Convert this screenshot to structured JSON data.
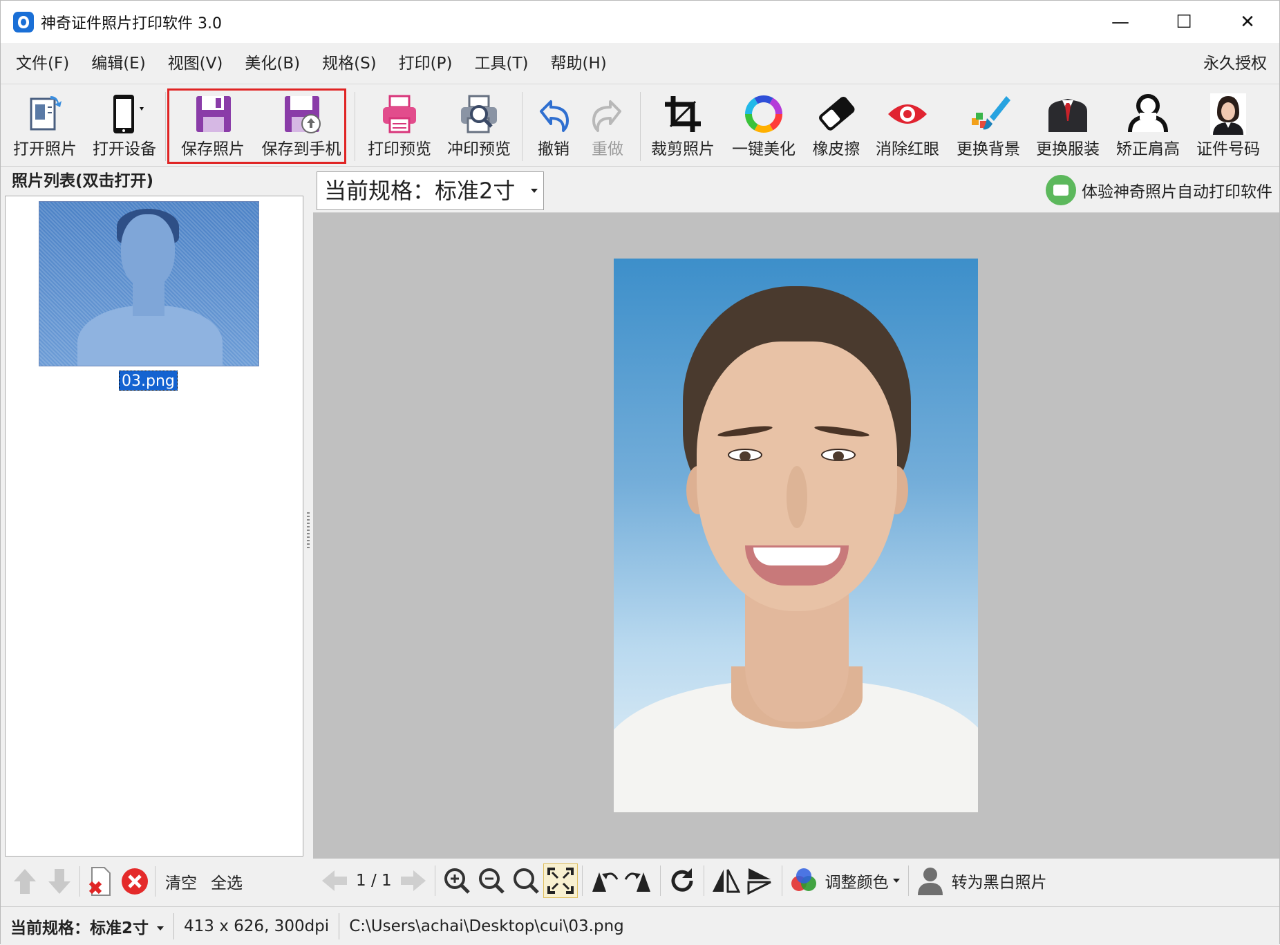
{
  "window": {
    "title": "神奇证件照片打印软件 3.0",
    "minimize": "—",
    "maximize": "☐",
    "close": "✕"
  },
  "menu": {
    "items": [
      "文件(F)",
      "编辑(E)",
      "视图(V)",
      "美化(B)",
      "规格(S)",
      "打印(P)",
      "工具(T)",
      "帮助(H)"
    ],
    "license": "永久授权"
  },
  "toolbar": {
    "open_photo": "打开照片",
    "open_device": "打开设备",
    "save_photo": "保存照片",
    "save_to_phone": "保存到手机",
    "print_preview": "打印预览",
    "develop_preview": "冲印预览",
    "undo": "撤销",
    "redo": "重做",
    "crop": "裁剪照片",
    "beautify": "一键美化",
    "eraser": "橡皮擦",
    "red_eye": "消除红眼",
    "change_bg": "更换背景",
    "change_clothes": "更换服装",
    "fix_shoulders": "矫正肩高",
    "id_number": "证件号码",
    "highlight_color": "#e02424"
  },
  "left_panel": {
    "header": "照片列表(双击打开)",
    "items": [
      {
        "name": "03.png",
        "selected": true
      }
    ],
    "clear": "清空",
    "select_all": "全选"
  },
  "main": {
    "spec_label": "当前规格：标准2寸",
    "promo": "体验神奇照片自动打印软件"
  },
  "bottom_bar": {
    "page": "1 / 1",
    "adjust_color": "调整颜色",
    "to_bw": "转为黑白照片"
  },
  "status": {
    "spec": "当前规格：标准2寸",
    "size": "413 x 626, 300dpi",
    "path": "C:\\Users\\achai\\Desktop\\cui\\03.png"
  }
}
